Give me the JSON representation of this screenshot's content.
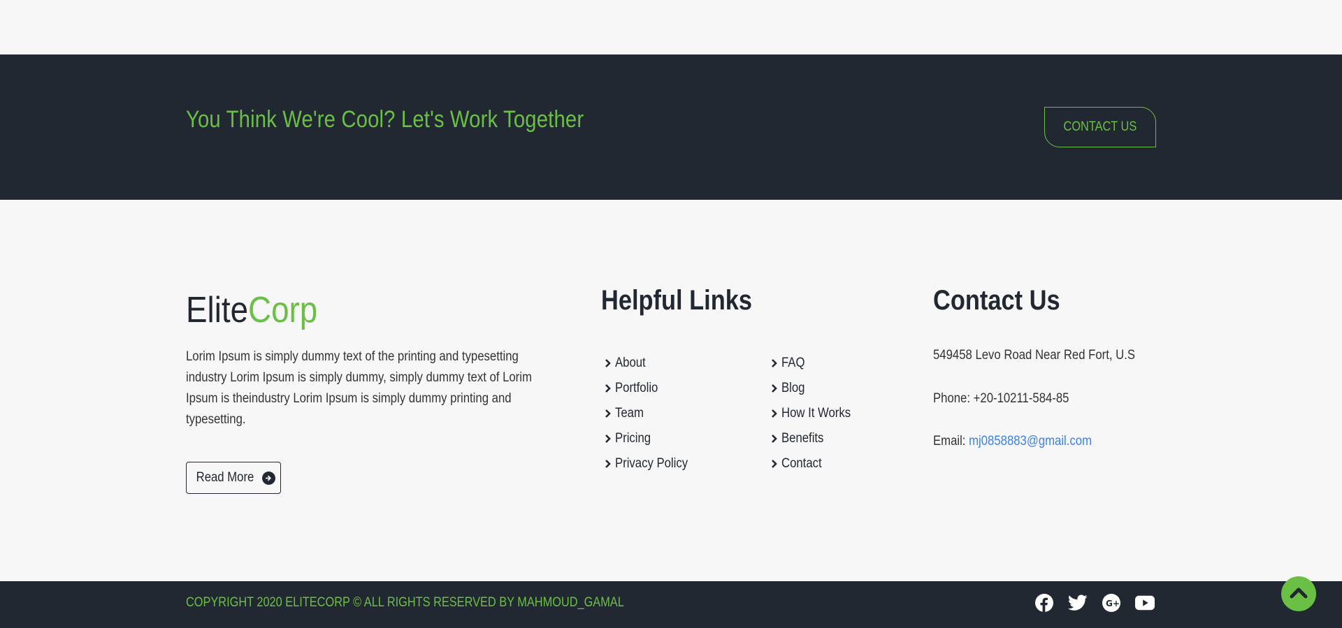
{
  "cta": {
    "title": "You Think We're Cool? Let's Work Together",
    "button_label": "CONTACT US"
  },
  "brand": {
    "part1": "Elite",
    "part2": "Corp",
    "description": "Lorim Ipsum is simply dummy text of the printing and typesetting industry Lorim Ipsum is simply dummy, simply dummy text of Lorim Ipsum is theindustry Lorim Ipsum is simply dummy printing and typesetting.",
    "read_more_label": "Read More",
    "read_more_icon": "arrow-circle-right-icon"
  },
  "helpful_links": {
    "title": "Helpful Links",
    "column1": [
      "About",
      "Portfolio",
      "Team",
      "Pricing",
      "Privacy Policy"
    ],
    "column2": [
      "FAQ",
      "Blog",
      "How It Works",
      "Benefits",
      "Contact"
    ],
    "item_icon": "chevron-right-icon"
  },
  "contact": {
    "title": "Contact Us",
    "address": "549458 Levo Road Near Red Fort, U.S",
    "phone_label": "Phone:",
    "phone": "+20-10211-584-85",
    "email_label": "Email:",
    "email": "mj0858883@gmail.com"
  },
  "footer": {
    "copyright": "COPYRIGHT 2020 ELITECORP © ALL RIGHTS RESERVED BY MAHMOUD_GAMAL",
    "socials": [
      "facebook-icon",
      "twitter-icon",
      "google-plus-icon",
      "youtube-icon"
    ]
  },
  "scroll_top_icon": "chevron-up-icon",
  "colors": {
    "dark": "#222831",
    "accent": "#6ac045",
    "link": "#3b82e8",
    "background": "#f7f7f7"
  }
}
